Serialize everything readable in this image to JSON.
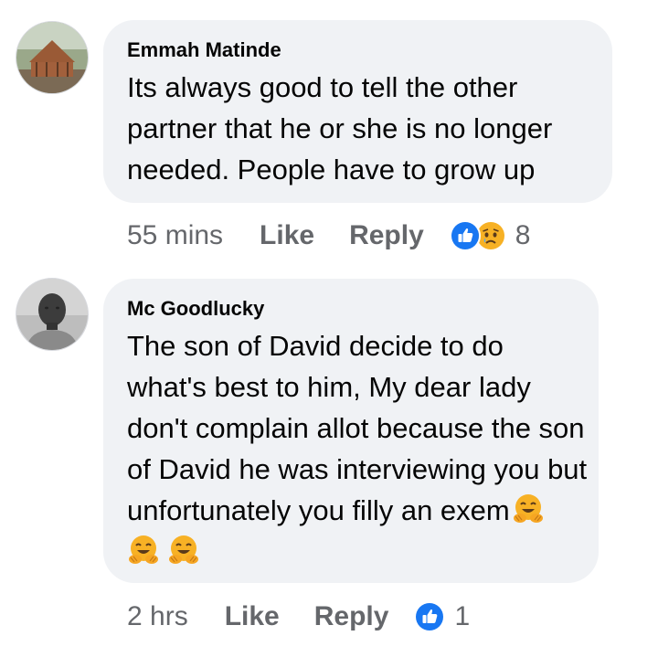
{
  "comments": [
    {
      "author": "Emmah Matinde",
      "text": "Its always good to tell the other partner that he or she is no longer needed. People have to grow up",
      "time": "55 mins",
      "like_label": "Like",
      "reply_label": "Reply",
      "reactions": [
        "like-icon",
        "sad-icon"
      ],
      "reaction_count": "8"
    },
    {
      "author": "Mc Goodlucky",
      "text": "The son of David decide to do what's best to him,  My dear lady don't complain allot because the son of David he was interviewing you but unfortunately you filly an exem",
      "emojis": [
        "hugging-face-emoji",
        "hugging-face-emoji",
        "hugging-face-emoji"
      ],
      "time": "2 hrs",
      "like_label": "Like",
      "reply_label": "Reply",
      "reactions": [
        "like-icon"
      ],
      "reaction_count": "1"
    }
  ],
  "colors": {
    "bubble": "#f0f2f5",
    "meta_text": "#65676b",
    "like_blue": "#1877f2",
    "sad_yellow": "#f7b125"
  }
}
